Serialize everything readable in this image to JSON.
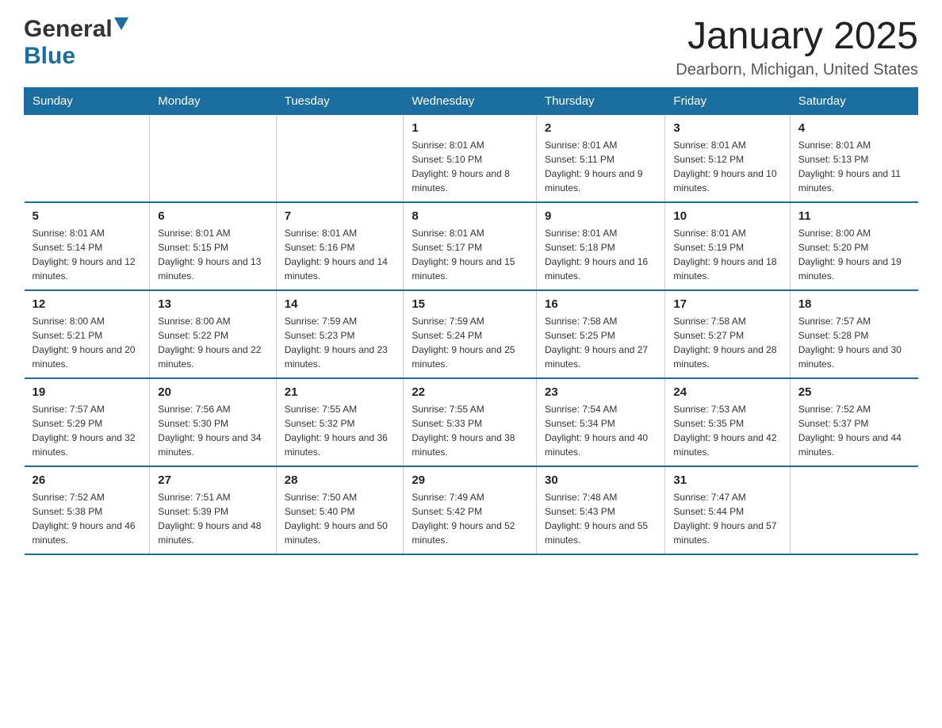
{
  "header": {
    "logo_general": "General",
    "logo_blue": "Blue",
    "month_title": "January 2025",
    "location": "Dearborn, Michigan, United States"
  },
  "days_of_week": [
    "Sunday",
    "Monday",
    "Tuesday",
    "Wednesday",
    "Thursday",
    "Friday",
    "Saturday"
  ],
  "weeks": [
    [
      {
        "day": "",
        "info": ""
      },
      {
        "day": "",
        "info": ""
      },
      {
        "day": "",
        "info": ""
      },
      {
        "day": "1",
        "info": "Sunrise: 8:01 AM\nSunset: 5:10 PM\nDaylight: 9 hours and 8 minutes."
      },
      {
        "day": "2",
        "info": "Sunrise: 8:01 AM\nSunset: 5:11 PM\nDaylight: 9 hours and 9 minutes."
      },
      {
        "day": "3",
        "info": "Sunrise: 8:01 AM\nSunset: 5:12 PM\nDaylight: 9 hours and 10 minutes."
      },
      {
        "day": "4",
        "info": "Sunrise: 8:01 AM\nSunset: 5:13 PM\nDaylight: 9 hours and 11 minutes."
      }
    ],
    [
      {
        "day": "5",
        "info": "Sunrise: 8:01 AM\nSunset: 5:14 PM\nDaylight: 9 hours and 12 minutes."
      },
      {
        "day": "6",
        "info": "Sunrise: 8:01 AM\nSunset: 5:15 PM\nDaylight: 9 hours and 13 minutes."
      },
      {
        "day": "7",
        "info": "Sunrise: 8:01 AM\nSunset: 5:16 PM\nDaylight: 9 hours and 14 minutes."
      },
      {
        "day": "8",
        "info": "Sunrise: 8:01 AM\nSunset: 5:17 PM\nDaylight: 9 hours and 15 minutes."
      },
      {
        "day": "9",
        "info": "Sunrise: 8:01 AM\nSunset: 5:18 PM\nDaylight: 9 hours and 16 minutes."
      },
      {
        "day": "10",
        "info": "Sunrise: 8:01 AM\nSunset: 5:19 PM\nDaylight: 9 hours and 18 minutes."
      },
      {
        "day": "11",
        "info": "Sunrise: 8:00 AM\nSunset: 5:20 PM\nDaylight: 9 hours and 19 minutes."
      }
    ],
    [
      {
        "day": "12",
        "info": "Sunrise: 8:00 AM\nSunset: 5:21 PM\nDaylight: 9 hours and 20 minutes."
      },
      {
        "day": "13",
        "info": "Sunrise: 8:00 AM\nSunset: 5:22 PM\nDaylight: 9 hours and 22 minutes."
      },
      {
        "day": "14",
        "info": "Sunrise: 7:59 AM\nSunset: 5:23 PM\nDaylight: 9 hours and 23 minutes."
      },
      {
        "day": "15",
        "info": "Sunrise: 7:59 AM\nSunset: 5:24 PM\nDaylight: 9 hours and 25 minutes."
      },
      {
        "day": "16",
        "info": "Sunrise: 7:58 AM\nSunset: 5:25 PM\nDaylight: 9 hours and 27 minutes."
      },
      {
        "day": "17",
        "info": "Sunrise: 7:58 AM\nSunset: 5:27 PM\nDaylight: 9 hours and 28 minutes."
      },
      {
        "day": "18",
        "info": "Sunrise: 7:57 AM\nSunset: 5:28 PM\nDaylight: 9 hours and 30 minutes."
      }
    ],
    [
      {
        "day": "19",
        "info": "Sunrise: 7:57 AM\nSunset: 5:29 PM\nDaylight: 9 hours and 32 minutes."
      },
      {
        "day": "20",
        "info": "Sunrise: 7:56 AM\nSunset: 5:30 PM\nDaylight: 9 hours and 34 minutes."
      },
      {
        "day": "21",
        "info": "Sunrise: 7:55 AM\nSunset: 5:32 PM\nDaylight: 9 hours and 36 minutes."
      },
      {
        "day": "22",
        "info": "Sunrise: 7:55 AM\nSunset: 5:33 PM\nDaylight: 9 hours and 38 minutes."
      },
      {
        "day": "23",
        "info": "Sunrise: 7:54 AM\nSunset: 5:34 PM\nDaylight: 9 hours and 40 minutes."
      },
      {
        "day": "24",
        "info": "Sunrise: 7:53 AM\nSunset: 5:35 PM\nDaylight: 9 hours and 42 minutes."
      },
      {
        "day": "25",
        "info": "Sunrise: 7:52 AM\nSunset: 5:37 PM\nDaylight: 9 hours and 44 minutes."
      }
    ],
    [
      {
        "day": "26",
        "info": "Sunrise: 7:52 AM\nSunset: 5:38 PM\nDaylight: 9 hours and 46 minutes."
      },
      {
        "day": "27",
        "info": "Sunrise: 7:51 AM\nSunset: 5:39 PM\nDaylight: 9 hours and 48 minutes."
      },
      {
        "day": "28",
        "info": "Sunrise: 7:50 AM\nSunset: 5:40 PM\nDaylight: 9 hours and 50 minutes."
      },
      {
        "day": "29",
        "info": "Sunrise: 7:49 AM\nSunset: 5:42 PM\nDaylight: 9 hours and 52 minutes."
      },
      {
        "day": "30",
        "info": "Sunrise: 7:48 AM\nSunset: 5:43 PM\nDaylight: 9 hours and 55 minutes."
      },
      {
        "day": "31",
        "info": "Sunrise: 7:47 AM\nSunset: 5:44 PM\nDaylight: 9 hours and 57 minutes."
      },
      {
        "day": "",
        "info": ""
      }
    ]
  ],
  "colors": {
    "header_bg": "#1a6fa0",
    "header_text": "#ffffff",
    "border": "#1a6fa0",
    "text_dark": "#222222",
    "text_medium": "#555555"
  }
}
